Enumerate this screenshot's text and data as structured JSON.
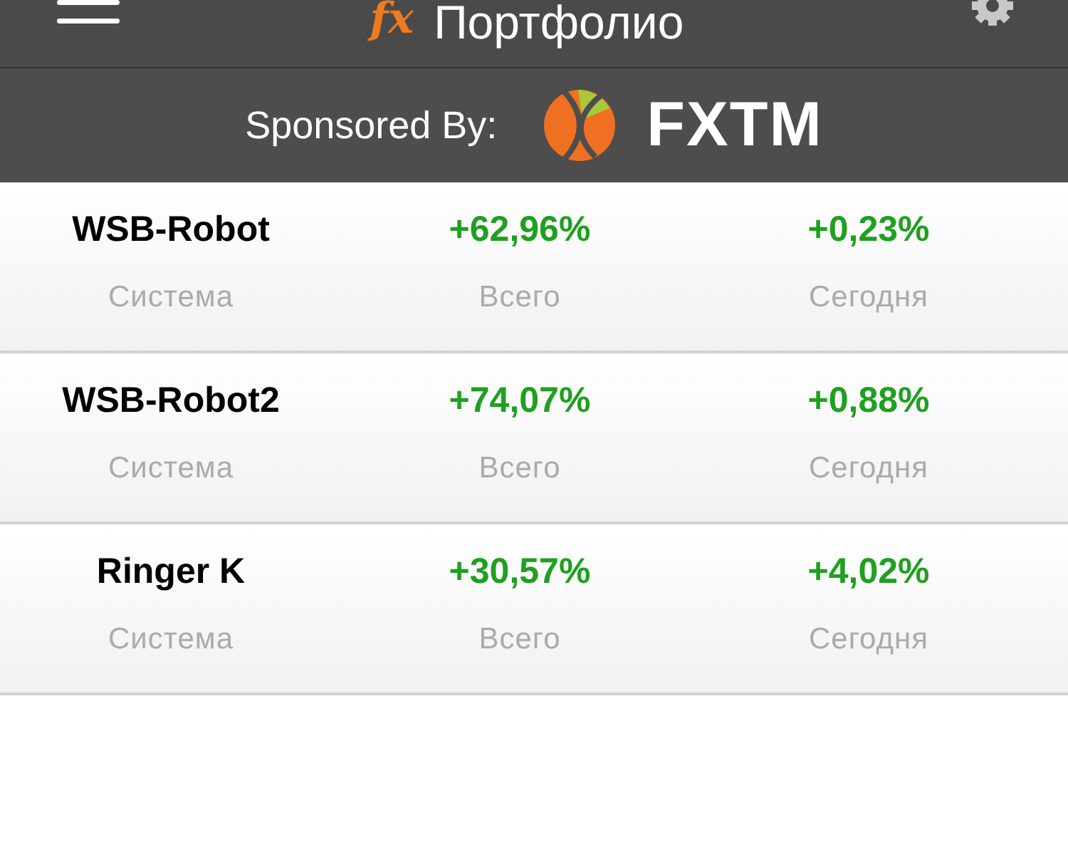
{
  "top_bar": {
    "logo": "fx",
    "title": "Портфолио"
  },
  "sponsor": {
    "label": "Sponsored By:",
    "brand": "FXTM"
  },
  "systems": [
    {
      "cells": [
        {
          "kind": "name",
          "value": "WSB-Robot",
          "label": "Система"
        },
        {
          "kind": "change",
          "value": "+62,96%",
          "label": "Всего"
        },
        {
          "kind": "change",
          "value": "+0,23%",
          "label": "Сегодня"
        }
      ]
    },
    {
      "cells": [
        {
          "kind": "name",
          "value": "WSB-Robot2",
          "label": "Система"
        },
        {
          "kind": "change",
          "value": "+74,07%",
          "label": "Всего"
        },
        {
          "kind": "change",
          "value": "+0,88%",
          "label": "Сегодня"
        }
      ]
    },
    {
      "cells": [
        {
          "kind": "name",
          "value": "Ringer K",
          "label": "Система"
        },
        {
          "kind": "change",
          "value": "+30,57%",
          "label": "Всего"
        },
        {
          "kind": "change",
          "value": "+4,02%",
          "label": "Сегодня"
        }
      ]
    }
  ]
}
